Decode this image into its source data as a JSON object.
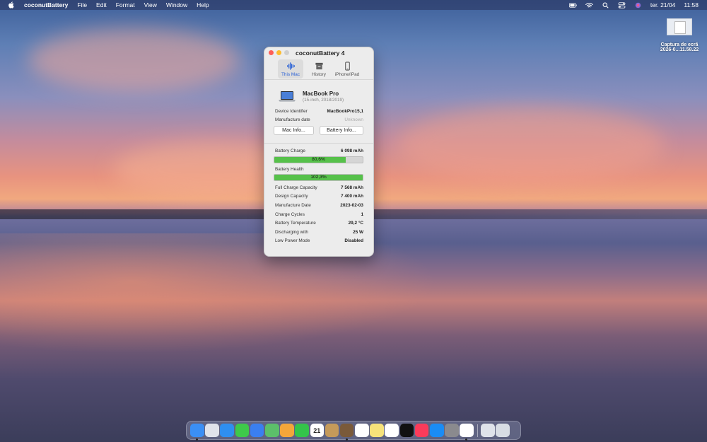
{
  "menubar": {
    "app_name": "coconutBattery",
    "menus": [
      "File",
      "Edit",
      "Format",
      "View",
      "Window",
      "Help"
    ],
    "date": "ter. 21/04",
    "time": "11:58"
  },
  "desktop_file": {
    "line1": "Captura de ecrã",
    "line2": "2026-0...11.58.22"
  },
  "window": {
    "title": "coconutBattery 4",
    "tabs": [
      {
        "label": "This Mac",
        "icon": "waveform-icon",
        "active": true
      },
      {
        "label": "History",
        "icon": "archive-icon",
        "active": false
      },
      {
        "label": "iPhone/iPad",
        "icon": "phone-icon",
        "active": false
      }
    ],
    "device": {
      "name": "MacBook Pro",
      "subtitle": "(15-inch, 2018/2019)"
    },
    "info": {
      "identifier_label": "Device Identifier",
      "identifier_value": "MacBookPro15,1",
      "manufacture_label": "Manufacture date",
      "manufacture_value": "Unknown"
    },
    "buttons": {
      "mac_info": "Mac Info...",
      "battery_info": "Battery Info..."
    },
    "battery": {
      "charge_label": "Battery Charge",
      "charge_value": "6 098 mAh",
      "charge_percent_text": "80,6%",
      "charge_percent": 80.6,
      "health_label": "Battery Health",
      "health_percent_text": "102,3%",
      "health_percent": 102.3
    },
    "stats": [
      {
        "label": "Full Charge Capacity",
        "value": "7 568 mAh"
      },
      {
        "label": "Design Capacity",
        "value": "7 400 mAh"
      },
      {
        "label": "Manufacture Date",
        "value": "2023-02-03"
      },
      {
        "label": "Charge Cycles",
        "value": "1"
      },
      {
        "label": "Battery Temperature",
        "value": "29,2 °C"
      },
      {
        "label": "Discharging with",
        "value": "25 W"
      },
      {
        "label": "Low Power Mode",
        "value": "Disabled"
      }
    ]
  },
  "dock": {
    "icons": [
      {
        "name": "finder-icon",
        "color": "#3b8ff5",
        "running": true
      },
      {
        "name": "launchpad-icon",
        "color": "#e0e3ea",
        "running": false
      },
      {
        "name": "safari-icon",
        "color": "#2f8ff0",
        "running": false
      },
      {
        "name": "messages-icon",
        "color": "#3ec94a",
        "running": false
      },
      {
        "name": "mail-icon",
        "color": "#3a7ff0",
        "running": false
      },
      {
        "name": "maps-icon",
        "color": "#5cbf6a",
        "running": false
      },
      {
        "name": "photos-icon",
        "color": "#f4a63a",
        "running": false
      },
      {
        "name": "facetime-icon",
        "color": "#34c44a",
        "running": false
      },
      {
        "name": "calendar-icon",
        "color": "#ffffff",
        "running": false
      },
      {
        "name": "contacts-icon",
        "color": "#c59a5a",
        "running": false
      },
      {
        "name": "coconutbattery-icon",
        "color": "#7a5a3a",
        "running": true
      },
      {
        "name": "reminders-icon",
        "color": "#ffffff",
        "running": false
      },
      {
        "name": "notes-icon",
        "color": "#f6e27a",
        "running": false
      },
      {
        "name": "freeform-icon",
        "color": "#ffffff",
        "running": false
      },
      {
        "name": "appletv-icon",
        "color": "#111111",
        "running": false
      },
      {
        "name": "music-icon",
        "color": "#fb3b5a",
        "running": false
      },
      {
        "name": "appstore-icon",
        "color": "#1a8cf5",
        "running": false
      },
      {
        "name": "system-settings-icon",
        "color": "#8a8a8e",
        "running": false
      },
      {
        "name": "chrome-icon",
        "color": "#ffffff",
        "running": true
      }
    ],
    "right_icons": [
      {
        "name": "screenshot-folder-icon",
        "color": "#dfe3ea"
      },
      {
        "name": "trash-icon",
        "color": "#d8dde4"
      }
    ],
    "calendar_day": "21"
  }
}
